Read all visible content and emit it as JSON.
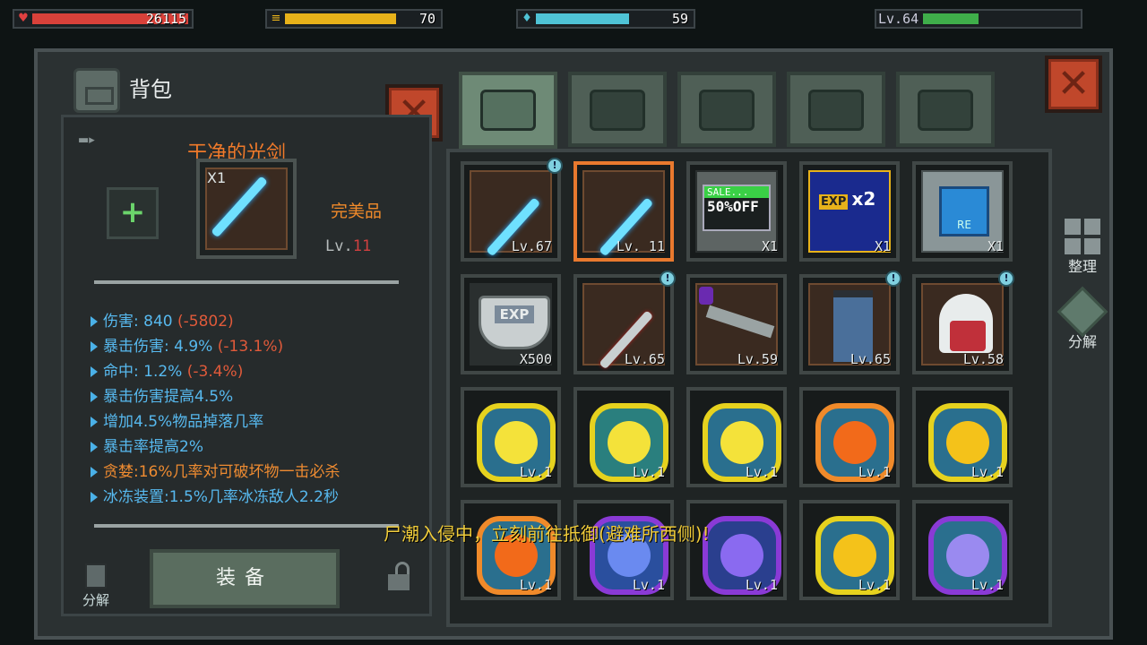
{
  "status_bars": {
    "health": {
      "value": "26115",
      "fill": 0.92,
      "color": "#d9413a"
    },
    "hunger": {
      "value": "70",
      "fill": 0.7,
      "color": "#e8b21a"
    },
    "thirst": {
      "value": "59",
      "fill": 0.59,
      "color": "#4fc3d6"
    },
    "level": {
      "label": "Lv.64",
      "fill": 0.36,
      "color": "#3fae4a"
    }
  },
  "panel": {
    "title": "背包",
    "tabs": [
      "backpack-tab",
      "medical-tab",
      "armor-tab",
      "weapon-tab",
      "tools-tab"
    ]
  },
  "detail": {
    "item_name": "干净的光剑",
    "quality": "完美品",
    "level_prefix": "Lv.",
    "level_value": "11",
    "count": "X1",
    "stats": [
      {
        "label": "伤害: 840 ",
        "delta": "(-5802)",
        "style": "blue"
      },
      {
        "label": "暴击伤害: 4.9% ",
        "delta": "(-13.1%)",
        "style": "blue"
      },
      {
        "label": "命中: 1.2% ",
        "delta": "(-3.4%)",
        "style": "blue"
      },
      {
        "label": "暴击伤害提高4.5%",
        "delta": "",
        "style": "blue"
      },
      {
        "label": "增加4.5%物品掉落几率",
        "delta": "",
        "style": "blue"
      },
      {
        "label": "暴击率提高2%",
        "delta": "",
        "style": "blue"
      },
      {
        "label": "贪婪:16%几率对可破坏物一击必杀",
        "delta": "",
        "style": "orange"
      },
      {
        "label": "冰冻装置:1.5%几率冰冻敌人2.2秒",
        "delta": "",
        "style": "blue"
      }
    ],
    "equip_label": "装备",
    "discard_label": "分解"
  },
  "grid": {
    "items": [
      {
        "kind": "sword",
        "text": "Lv.67",
        "badge": "!"
      },
      {
        "kind": "sword",
        "text": "Lv. 11",
        "selected": true
      },
      {
        "kind": "sale",
        "text": "X1",
        "top": "SALE...",
        "main": "50%OFF"
      },
      {
        "kind": "exp2",
        "text": "X1",
        "top": "EXP",
        "main": "x2"
      },
      {
        "kind": "reset",
        "text": "X1",
        "top": "RE"
      },
      {
        "kind": "exp",
        "text": "X500",
        "top": "EXP"
      },
      {
        "kind": "blade",
        "text": "Lv.65",
        "badge": "!"
      },
      {
        "kind": "crossbow",
        "text": "Lv.59"
      },
      {
        "kind": "pants",
        "text": "Lv.65",
        "badge": "!"
      },
      {
        "kind": "hood",
        "text": "Lv.58",
        "badge": "!"
      },
      {
        "kind": "chip-yellow-sun",
        "text": "Lv.1"
      },
      {
        "kind": "chip-yellow-cross",
        "text": "Lv.1"
      },
      {
        "kind": "chip-yellow-sun",
        "text": "Lv.1"
      },
      {
        "kind": "chip-orange-fire",
        "text": "Lv.1"
      },
      {
        "kind": "chip-yellow-fire",
        "text": "Lv.1"
      },
      {
        "kind": "chip-orange-cross",
        "text": "Lv.1"
      },
      {
        "kind": "chip-purple-blue",
        "text": "Lv.1"
      },
      {
        "kind": "chip-purple-fire",
        "text": "Lv.1"
      },
      {
        "kind": "chip-yellow-fire",
        "text": "Lv.1"
      },
      {
        "kind": "chip-purple-cross",
        "text": "Lv.1"
      }
    ]
  },
  "sidebar": {
    "sort_label": "整理",
    "salvage_label": "分解"
  },
  "broadcast": "尸潮入侵中，立刻前往抵御(避难所西侧)!"
}
